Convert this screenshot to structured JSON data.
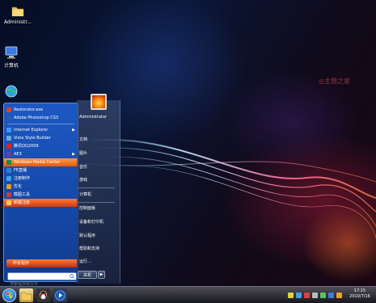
{
  "desktop": {
    "icons": [
      {
        "label": "Administr...",
        "icon": "folder-icon"
      },
      {
        "label": "计算机",
        "icon": "computer-icon"
      },
      {
        "label": "",
        "icon": "globe-icon"
      }
    ],
    "watermark": "◎主题之家"
  },
  "start_menu": {
    "pinned_items": [
      {
        "label": "Restorator.exe",
        "icon": "app-icon",
        "color": "#e04020"
      },
      {
        "label": "Adobe Photoshop CS3",
        "icon": "photoshop-icon",
        "color": "#2a5db0"
      },
      {
        "label": "Internet Explorer",
        "icon": "ie-icon",
        "color": "#3a9aff",
        "arrow": "▶"
      },
      {
        "label": "Vista Style Builder",
        "icon": "app-icon",
        "color": "#66aadd"
      },
      {
        "label": "腾讯QQ2009",
        "icon": "qq-icon",
        "color": "#e02020"
      },
      {
        "label": "AE3",
        "icon": "app-icon",
        "color": "#6a40a0",
        "arrow": "▶"
      },
      {
        "label": "Windows Media Center",
        "icon": "media-center-icon",
        "color": "#1a8a40"
      },
      {
        "label": "FE直播",
        "icon": "app-icon",
        "color": "#2a80d0"
      },
      {
        "label": "注册制作",
        "icon": "app-icon",
        "color": "#40a0e0"
      },
      {
        "label": "优化",
        "icon": "app-icon",
        "color": "#e0a020"
      },
      {
        "label": "截图工具",
        "icon": "scissors-icon",
        "color": "#c04040"
      },
      {
        "label": "卸载注册",
        "icon": "app-icon",
        "color": "#e06020"
      }
    ],
    "all_programs": "所有程序",
    "search_placeholder": "搜索程序和文件",
    "user_name": "Administrator",
    "right_items": [
      "文档",
      "图片",
      "音乐",
      "游戏",
      "计算机",
      "控制面板",
      "设备和打印机",
      "默认程序",
      "帮助和支持",
      "运行..."
    ],
    "shutdown_label": "关机",
    "shutdown_arrow": "▶"
  },
  "taskbar": {
    "clock_time": "17:15",
    "clock_date": "2010/7/16"
  }
}
